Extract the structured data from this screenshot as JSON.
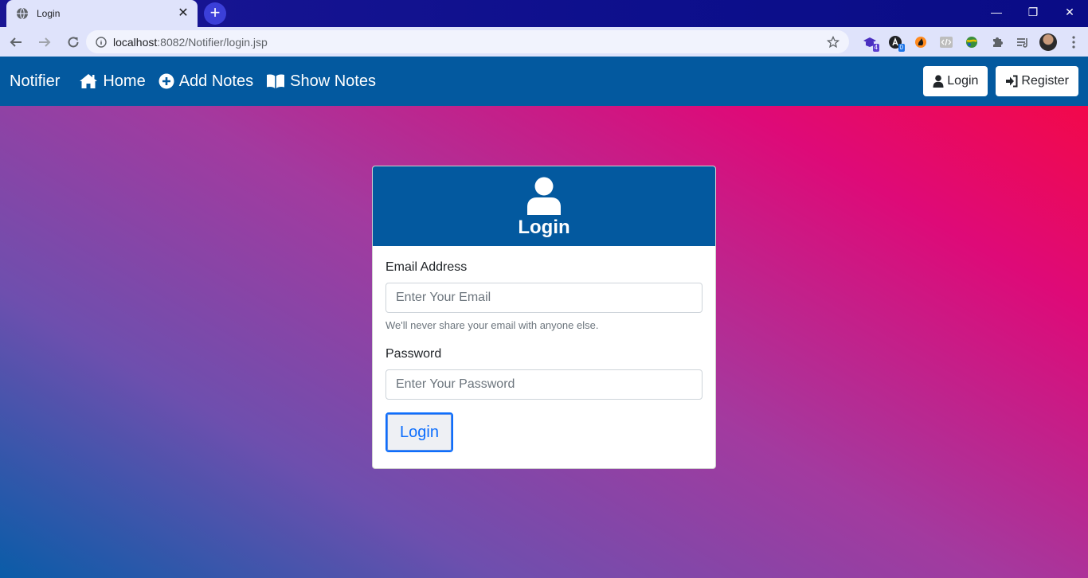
{
  "browser": {
    "tab_title": "Login",
    "tab_close": "✕",
    "new_tab": "+",
    "url_host": "localhost",
    "url_rest": ":8082/Notifier/login.jsp",
    "window_controls": {
      "minimize": "—",
      "restore": "❐",
      "close": "✕"
    },
    "extensions": [
      {
        "icon": "graduation-cap-icon",
        "badge": "4",
        "badge_color": "#5b3fd0"
      },
      {
        "icon": "a-circle-icon",
        "badge": "0",
        "badge_color": "#1a73e8"
      },
      {
        "icon": "flame-icon"
      },
      {
        "icon": "code-icon"
      },
      {
        "icon": "globe-icon"
      },
      {
        "icon": "puzzle-icon"
      },
      {
        "icon": "reading-list-icon"
      },
      {
        "icon": "profile-avatar"
      },
      {
        "icon": "menu-dots-icon"
      }
    ]
  },
  "navbar": {
    "brand": "Notifier",
    "links": [
      {
        "label": "Home",
        "icon": "home-icon"
      },
      {
        "label": "Add Notes",
        "icon": "plus-circle-icon"
      },
      {
        "label": "Show Notes",
        "icon": "book-icon"
      }
    ],
    "buttons": [
      {
        "label": "Login",
        "icon": "user-icon"
      },
      {
        "label": "Register",
        "icon": "sign-in-icon"
      }
    ]
  },
  "login_card": {
    "title": "Login",
    "email_label": "Email Address",
    "email_placeholder": "Enter Your Email",
    "email_help": "We'll never share your email with anyone else.",
    "password_label": "Password",
    "password_placeholder": "Enter Your Password",
    "submit_label": "Login"
  },
  "colors": {
    "navbar": "#03599f",
    "primary": "#0d6efd",
    "gradient": [
      "#0a5ca8",
      "#a33a9f",
      "#de0a78",
      "#f7083f"
    ]
  }
}
